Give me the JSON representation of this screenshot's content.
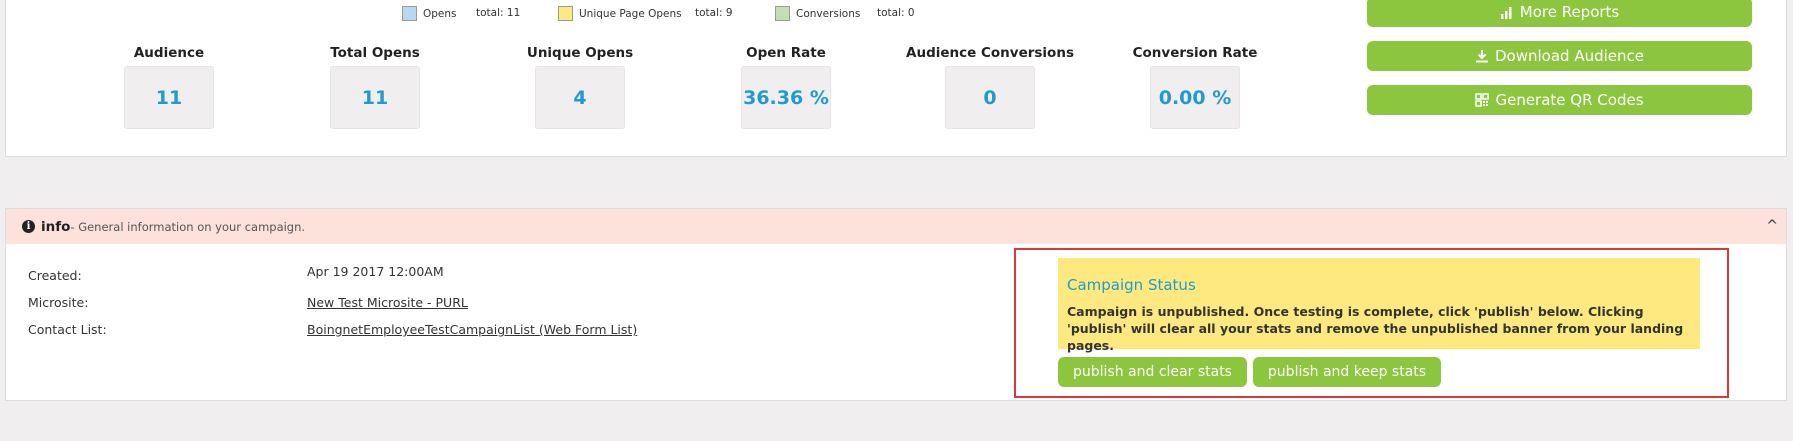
{
  "legend": [
    {
      "label": "Opens",
      "total": "total: 11",
      "color": "#b7d8ef"
    },
    {
      "label": "Unique Page Opens",
      "total": "total: 9",
      "color": "#fde980"
    },
    {
      "label": "Conversions",
      "total": "total: 0",
      "color": "#c4dfb0"
    }
  ],
  "stats": [
    {
      "label": "Audience",
      "value": "11"
    },
    {
      "label": "Total Opens",
      "value": "11"
    },
    {
      "label": "Unique Opens",
      "value": "4"
    },
    {
      "label": "Open Rate",
      "value": "36.36 %"
    },
    {
      "label": "Audience Conversions",
      "value": "0"
    },
    {
      "label": "Conversion Rate",
      "value": "0.00 %"
    }
  ],
  "side_buttons": {
    "more_reports": "More Reports",
    "download_audience": "Download Audience",
    "generate_qr": "Generate QR Codes"
  },
  "info": {
    "title": "info",
    "subtitle": " - General information on your campaign.",
    "collapse": "^",
    "created_label": "Created:",
    "created_value": "Apr 19 2017 12:00AM",
    "microsite_label": "Microsite:",
    "microsite_value": "New Test Microsite - PURL",
    "contact_label": "Contact List:",
    "contact_value": "BoingnetEmployeeTestCampaignList (Web Form List)"
  },
  "campaign_status": {
    "title": "Campaign Status",
    "text": "Campaign is unpublished. Once testing is complete, click 'publish' below. Clicking 'publish' will clear all your stats and remove the unpublished banner from your landing pages.",
    "publish_clear": "publish and clear stats",
    "publish_keep": "publish and keep stats"
  },
  "colors": {
    "accent_green": "#8cc63f",
    "value_blue": "#1f9bd1",
    "highlight_red": "#d9393b",
    "info_header_bg": "#fde1db",
    "status_bg": "#fde980"
  }
}
